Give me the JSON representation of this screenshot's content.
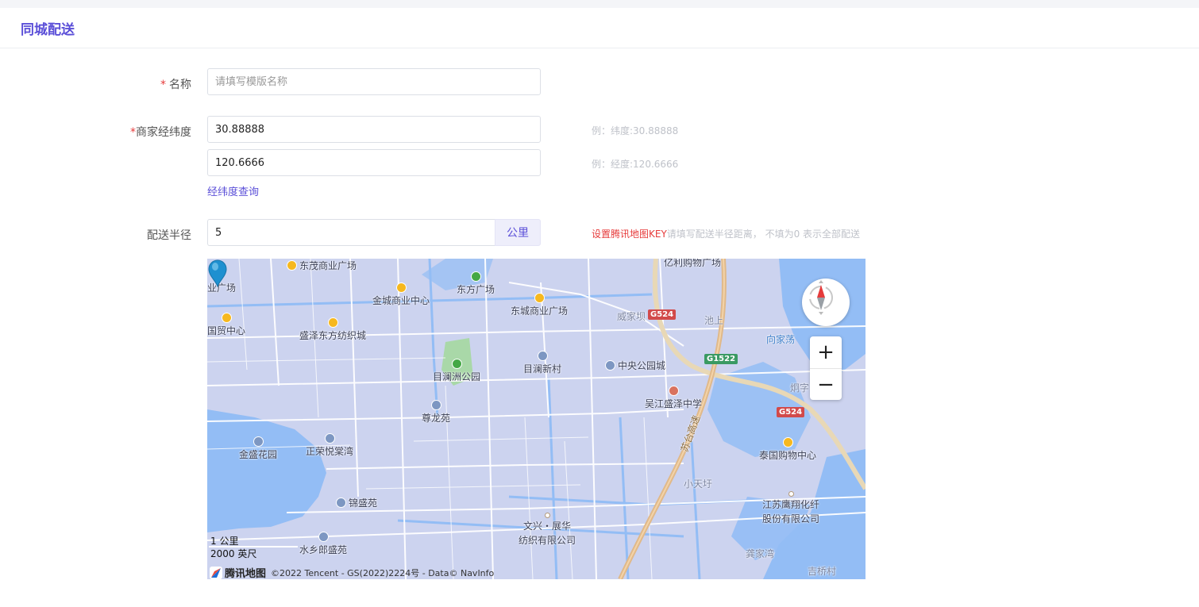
{
  "page": {
    "title": "同城配送"
  },
  "form": {
    "name": {
      "required_mark": "*",
      "label": "名称",
      "placeholder": "请填写模版名称",
      "value": ""
    },
    "coords": {
      "required_mark": "*",
      "label": "商家经纬度",
      "latitude": "30.88888",
      "longitude": "120.6666",
      "latitude_hint": "例：纬度:30.88888",
      "longitude_hint": "例：经度:120.6666",
      "query_link": "经纬度查询"
    },
    "radius": {
      "label": "配送半径",
      "value": "5",
      "unit": "公里",
      "key_link": "设置腾讯地图KEY",
      "hint": "请填写配送半径距离， 不填为0 表示全部配送"
    }
  },
  "map": {
    "pois": {
      "p1": "东方广场",
      "p2": "金城商业中心",
      "p3": "东城商业广场",
      "p4": "盛泽东方纺织城",
      "p5": "国贸中心",
      "p6": "业广场",
      "p7": "目澜洲公园",
      "p8": "目澜新村",
      "p9": "中央公园城",
      "p10": "尊龙苑",
      "p11": "吴江盛泽中学",
      "p12": "金盛花园",
      "p13": "正荣悦棠湾",
      "p14": "锦盛苑",
      "p15": "泰国购物中心",
      "p16": "江苏鹰翔化纤",
      "p16b": "股份有限公司",
      "p17": "文兴・展华",
      "p17b": "纺织有限公司",
      "p18": "水乡郎盛苑",
      "p19": "亿利购物广场",
      "p20": "威家坝",
      "p21": "池上",
      "p22": "向家荡",
      "p23": "炯字",
      "p24": "小天圩",
      "p25": "龚家湾",
      "p26": "吉桥村",
      "p27": "东茂商业广场",
      "road": "苏台高速"
    },
    "shields": {
      "s1": "G524",
      "s2": "G1522",
      "s3": "G524"
    },
    "scale_km": "1 公里",
    "scale_ft": "2000 英尺",
    "brand": "腾讯地图",
    "copyright": "©2022 Tencent - GS(2022)2224号 - Data© NavInfo",
    "zoom_in": "+",
    "zoom_out": "−",
    "colors": {
      "land": "#ccd3ef",
      "water": "#93bdf5",
      "road": "#ffffff",
      "highway": "#e0b98a",
      "accent": "#5b4fd8"
    }
  }
}
